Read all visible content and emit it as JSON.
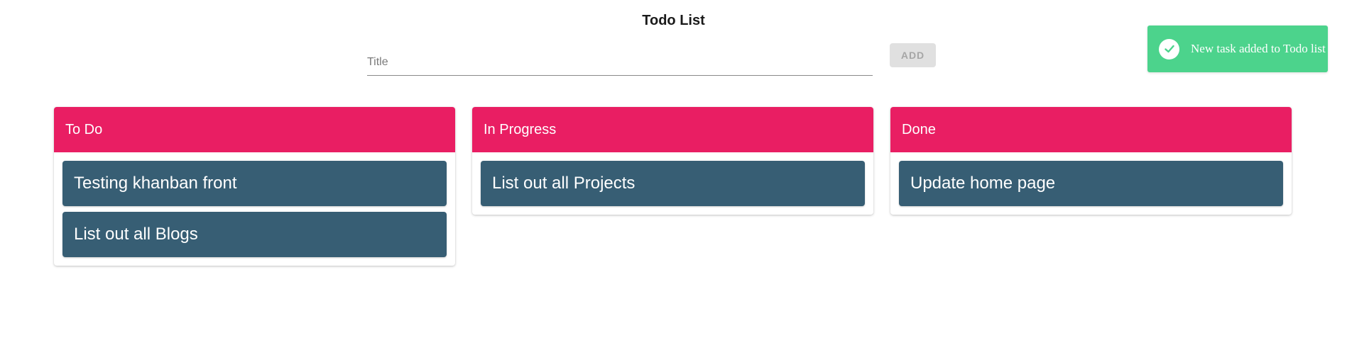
{
  "app": {
    "title": "Todo List"
  },
  "form": {
    "title_placeholder": "Title",
    "title_value": "",
    "add_label": "ADD"
  },
  "toast": {
    "message": "New task added to Todo list",
    "icon": "check-circle-icon",
    "color": "#4cd38c"
  },
  "colors": {
    "header": "#e91e63",
    "card": "#375e74"
  },
  "columns": [
    {
      "title": "To Do",
      "cards": [
        "Testing khanban front",
        "List out all Blogs"
      ]
    },
    {
      "title": "In Progress",
      "cards": [
        "List out all Projects"
      ]
    },
    {
      "title": "Done",
      "cards": [
        "Update home page"
      ]
    }
  ]
}
